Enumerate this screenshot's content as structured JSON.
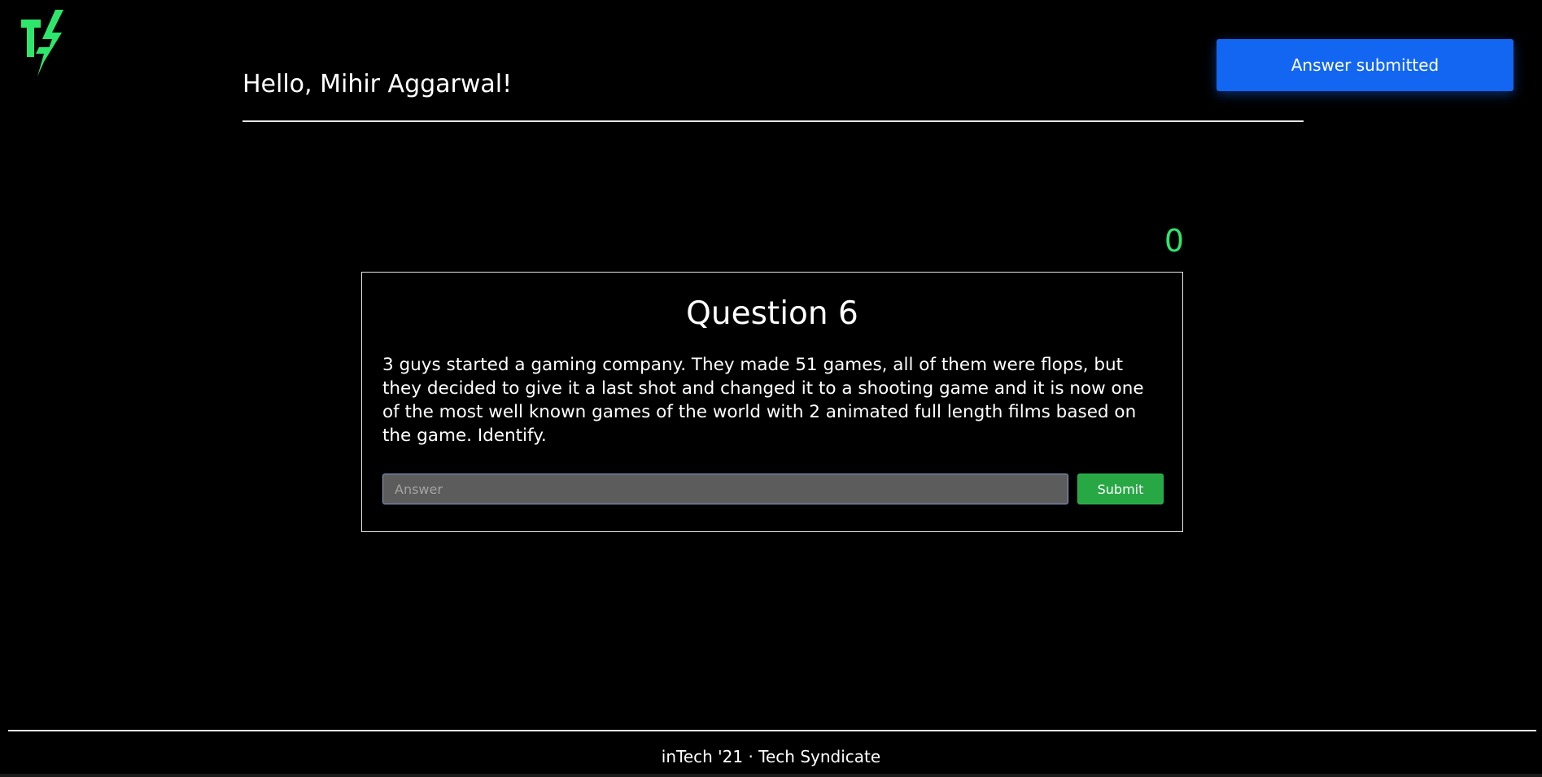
{
  "header": {
    "logo_icon": "tech-syndicate-lightning-logo",
    "greeting": "Hello, Mihir Aggarwal!"
  },
  "notification": {
    "message": "Answer submitted",
    "color": "#1266f1"
  },
  "score": {
    "value": "0",
    "color": "#2ee66b"
  },
  "question": {
    "title": "Question 6",
    "text": "3 guys started a gaming company. They made 51 games, all of them were flops, but they decided to give it a last shot and changed it to a shooting game and it is now one of the most well known games of the world with 2 animated full length films based on the game. Identify.",
    "answer_value": "",
    "answer_placeholder": "Answer",
    "submit_label": "Submit",
    "submit_color": "#28a745"
  },
  "footer": {
    "text": "inTech '21 · Tech Syndicate"
  }
}
